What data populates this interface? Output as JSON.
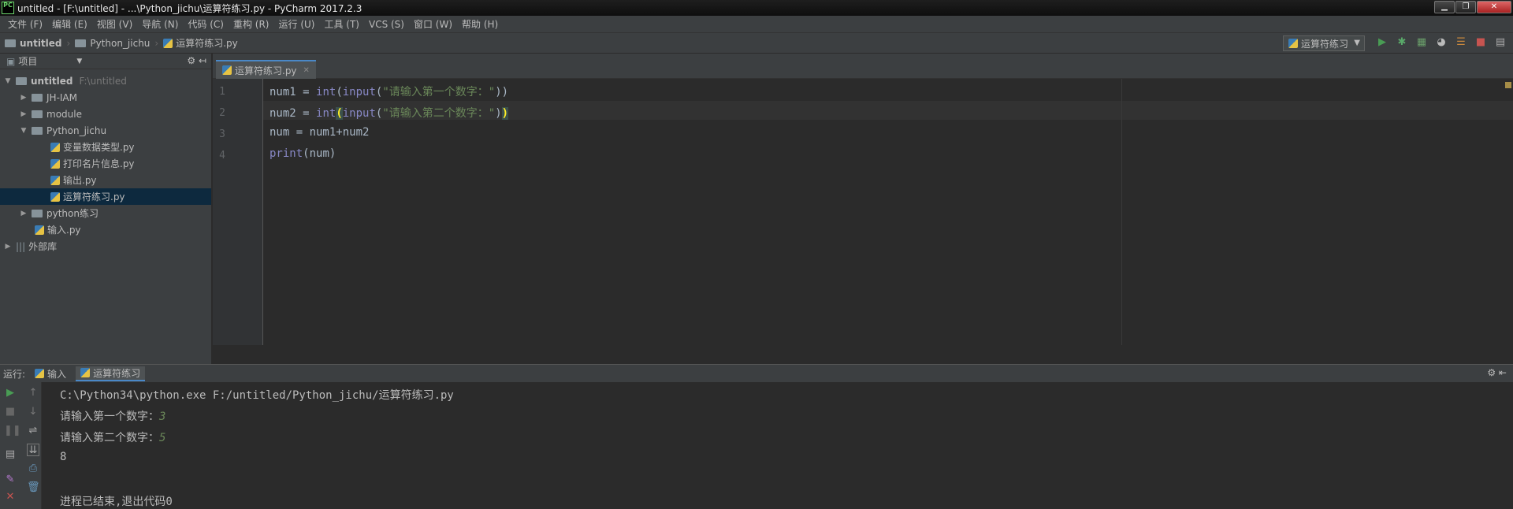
{
  "window": {
    "title": "untitled - [F:\\untitled] - ...\\Python_jichu\\运算符练习.py - PyCharm 2017.2.3",
    "app_icon": "PC"
  },
  "menu": [
    "文件 (F)",
    "编辑 (E)",
    "视图 (V)",
    "导航 (N)",
    "代码 (C)",
    "重构 (R)",
    "运行 (U)",
    "工具 (T)",
    "VCS (S)",
    "窗口 (W)",
    "帮助 (H)"
  ],
  "breadcrumb": [
    "untitled",
    "Python_jichu",
    "运算符练习.py"
  ],
  "run_config": "运算符练习",
  "project_panel": {
    "title": "项目",
    "tree": [
      {
        "label": "untitled",
        "hint": "F:\\untitled",
        "type": "folder",
        "expanded": true,
        "level": 0
      },
      {
        "label": "JH-IAM",
        "type": "folder",
        "expanded": false,
        "level": 1
      },
      {
        "label": "module",
        "type": "folder",
        "expanded": false,
        "level": 1
      },
      {
        "label": "Python_jichu",
        "type": "folder",
        "expanded": true,
        "level": 1
      },
      {
        "label": "变量数据类型.py",
        "type": "file",
        "level": 2
      },
      {
        "label": "打印名片信息.py",
        "type": "file",
        "level": 2
      },
      {
        "label": "输出.py",
        "type": "file",
        "level": 2
      },
      {
        "label": "运算符练习.py",
        "type": "file",
        "level": 2,
        "selected": true
      },
      {
        "label": "python练习",
        "type": "folder",
        "expanded": false,
        "level": 1
      },
      {
        "label": "输入.py",
        "type": "file",
        "level": 1
      },
      {
        "label": "外部库",
        "type": "lib",
        "expanded": false,
        "level": 0
      }
    ]
  },
  "editor": {
    "tab": "运算符练习.py",
    "line_numbers": [
      "1",
      "2",
      "3",
      "4"
    ]
  },
  "run_panel": {
    "label": "运行:",
    "tabs": [
      "输入",
      "运算符练习"
    ],
    "output": {
      "command": "C:\\Python34\\python.exe F:/untitled/Python_jichu/运算符练习.py",
      "prompt1": "请输入第一个数字：",
      "input1": "3",
      "prompt2": "请输入第二个数字：",
      "input2": "5",
      "result": "8",
      "exit": "进程已结束,退出代码0"
    }
  },
  "colors": {
    "accent": "#4a88c7",
    "selection": "#0d293e",
    "string": "#6a8759",
    "builtin": "#8888c6"
  }
}
